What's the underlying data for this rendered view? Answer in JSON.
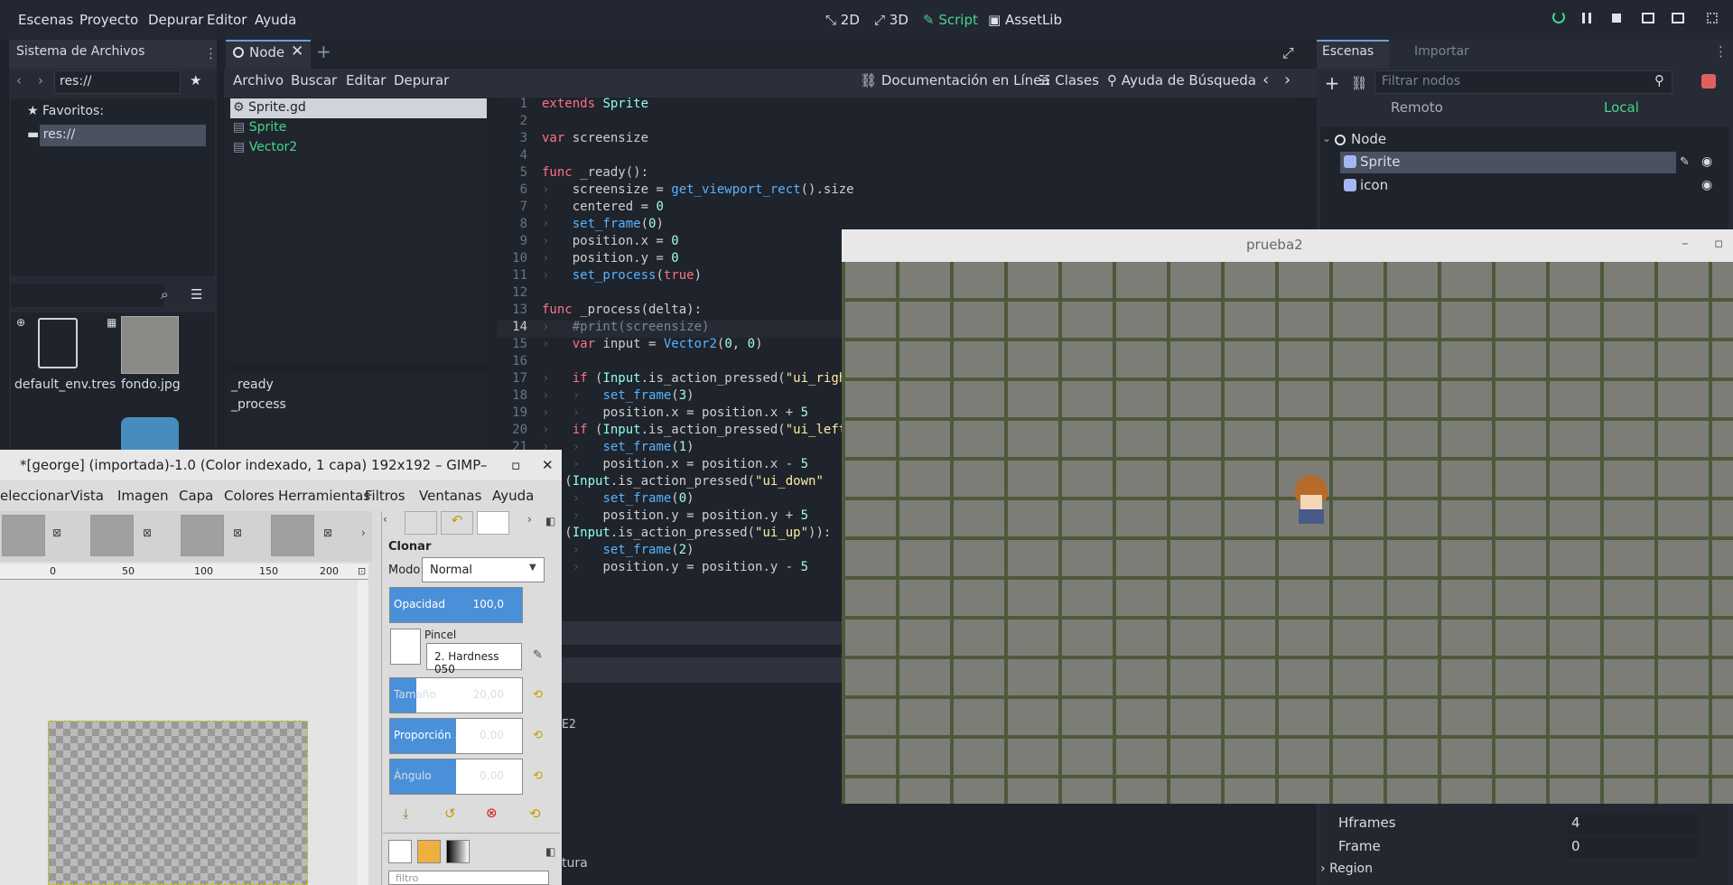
{
  "menubar": {
    "items": [
      "Escenas",
      "Proyecto",
      "Depurar",
      "Editor",
      "Ayuda"
    ]
  },
  "modes": {
    "m2d": "2D",
    "m3d": "3D",
    "script": "Script",
    "assetlib": "AssetLib"
  },
  "filesystem": {
    "title": "Sistema de Archivos",
    "path": "res://",
    "favorites_label": "Favoritos:",
    "res_item": "res://",
    "files": [
      {
        "name": "default_env.tres"
      },
      {
        "name": "fondo.jpg"
      }
    ]
  },
  "scene_tab": {
    "label": "Node"
  },
  "script_menu": {
    "items": [
      "Archivo",
      "Buscar",
      "Editar",
      "Depurar"
    ],
    "docs": "Documentación en Línea",
    "classes": "Clases",
    "search_help": "Ayuda de Búsqueda"
  },
  "script_list": {
    "items": [
      "Sprite.gd",
      "Sprite",
      "Vector2"
    ]
  },
  "methods": {
    "items": [
      "_ready",
      "_process"
    ]
  },
  "code": {
    "lines": [
      "extends Sprite",
      "",
      "var screensize",
      "",
      "func _ready():",
      "\tscreensize = get_viewport_rect().size",
      "\tcentered = 0",
      "\tset_frame(0)",
      "\tposition.x = 0",
      "\tposition.y = 0",
      "\tset_process(true)",
      "",
      "func _process(delta):",
      "\t#print(screensize)",
      "\tvar input = Vector2(0, 0)",
      "",
      "\tif (Input.is_action_pressed(\"ui_right\"",
      "\t\tset_frame(3)",
      "\t\tposition.x = position.x + 5",
      "\tif (Input.is_action_pressed(\"ui_left\"",
      "\t\tset_frame(1)",
      "\t\tposition.x = position.x - 5",
      "if (Input.is_action_pressed(\"ui_down\"",
      "\t\tset_frame(0)",
      "\t\tposition.y = position.y + 5",
      "if (Input.is_action_pressed(\"ui_up\")):",
      "\t\tset_frame(2)",
      "\t\tposition.y = position.y - 5",
      ""
    ]
  },
  "scene_dock": {
    "tab_scenes": "Escenas",
    "tab_import": "Importar",
    "filter_placeholder": "Filtrar nodos",
    "remote": "Remoto",
    "local": "Local",
    "tree": [
      "Node",
      "Sprite",
      "icon"
    ]
  },
  "inspector": {
    "rows": [
      {
        "label": "Hframes",
        "value": "4"
      },
      {
        "label": "Frame",
        "value": "0"
      },
      {
        "label": "Region",
        "value": ""
      }
    ]
  },
  "bottom": {
    "partial1": "E2",
    "partial2": "tura"
  },
  "game_window": {
    "title": "prueba2"
  },
  "gimp": {
    "title": "*[george] (importada)-1.0 (Color indexado, 1 capa) 192x192 – GIMP",
    "menu": [
      "eleccionar",
      "Vista",
      "Imagen",
      "Capa",
      "Colores",
      "Herramientas",
      "Filtros",
      "Ventanas",
      "Ayuda"
    ],
    "ruler": [
      "0",
      "50",
      "100",
      "150",
      "200"
    ],
    "tool_title": "Clonar",
    "mode_label": "Modo:",
    "mode_value": "Normal",
    "opacity": {
      "label": "Opacidad",
      "value": "100,0",
      "fraction": 1.0
    },
    "brush_label": "Pincel",
    "brush_value": "2. Hardness 050",
    "size": {
      "label": "Tamaño",
      "value": "20,00",
      "fraction": 0.2
    },
    "ratio": {
      "label": "Proporción ...",
      "value": "0,00",
      "fraction": 0.5
    },
    "angle": {
      "label": "Ángulo",
      "value": "0,00",
      "fraction": 0.5
    },
    "filter_placeholder": "filtro"
  }
}
